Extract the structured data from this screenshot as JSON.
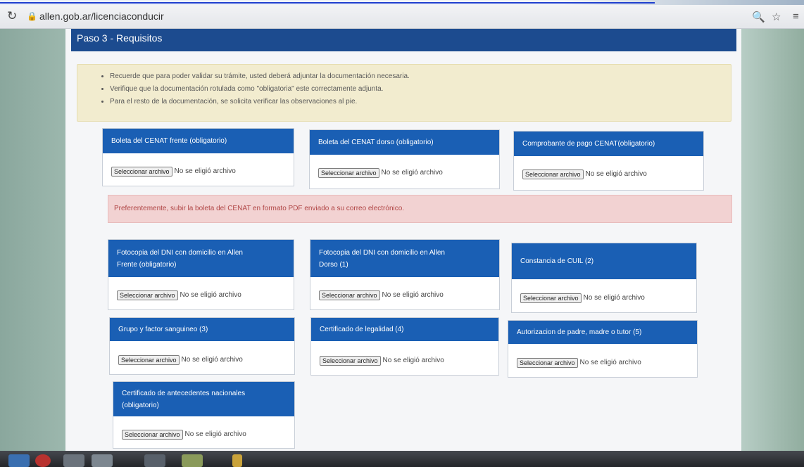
{
  "browser": {
    "url": "allen.gob.ar/licenciaconducir",
    "reload_icon": "reload-icon",
    "lock_icon": "lock-icon",
    "zoom_icon": "zoom-icon",
    "bookmark_icon": "star-icon",
    "menu_icon": "menu-icon"
  },
  "step": {
    "title": "Paso 3 - Requisitos"
  },
  "notice": {
    "items": [
      "Recuerde que para poder validar su trámite, usted deberá adjuntar la documentación necesaria.",
      "Verifique que la documentación rotulada como \"obligatoria\" este correctamente adjunta.",
      "Para el resto de la documentación, se solicita verificar las observaciones al pie."
    ]
  },
  "warning": {
    "text": "Preferentemente, subir la boleta del CENAT en formato PDF enviado a su correo electrónico."
  },
  "file_button_label": "Seleccionar archivo",
  "file_status": "No se eligió archivo",
  "cards": [
    {
      "title": "Boleta del CENAT frente (obligatorio)",
      "lines": [
        "Boleta del CENAT frente (obligatorio)"
      ]
    },
    {
      "title": "Boleta del CENAT dorso (obligatorio)",
      "lines": [
        "Boleta del CENAT dorso (obligatorio)"
      ]
    },
    {
      "title": "Comprobante de pago CENAT(obligatorio)",
      "lines": [
        "Comprobante de pago CENAT(obligatorio)"
      ]
    },
    {
      "title": "Fotocopia del DNI con domicilio en Allen Frente (obligatorio)",
      "lines": [
        "Fotocopia del DNI con domicilio en Allen",
        "Frente (obligatorio)"
      ]
    },
    {
      "title": "Fotocopia del DNI con domicilio en Allen Dorso (1)",
      "lines": [
        "Fotocopia del DNI con domicilio en Allen",
        "Dorso (1)"
      ]
    },
    {
      "title": "Constancia de CUIL (2)",
      "lines": [
        "Constancia de CUIL (2)"
      ]
    },
    {
      "title": "Grupo y factor sanguineo (3)",
      "lines": [
        "Grupo y factor sanguineo (3)"
      ]
    },
    {
      "title": "Certificado de legalidad (4)",
      "lines": [
        "Certificado de legalidad (4)"
      ]
    },
    {
      "title": "Autorizacion de padre, madre o tutor (5)",
      "lines": [
        "Autorizacion de padre, madre o tutor (5)"
      ]
    },
    {
      "title": "Certificado de antecedentes nacionales (obligatorio)",
      "lines": [
        "Certificado de antecedentes nacionales",
        "(obligatorio)"
      ]
    }
  ]
}
